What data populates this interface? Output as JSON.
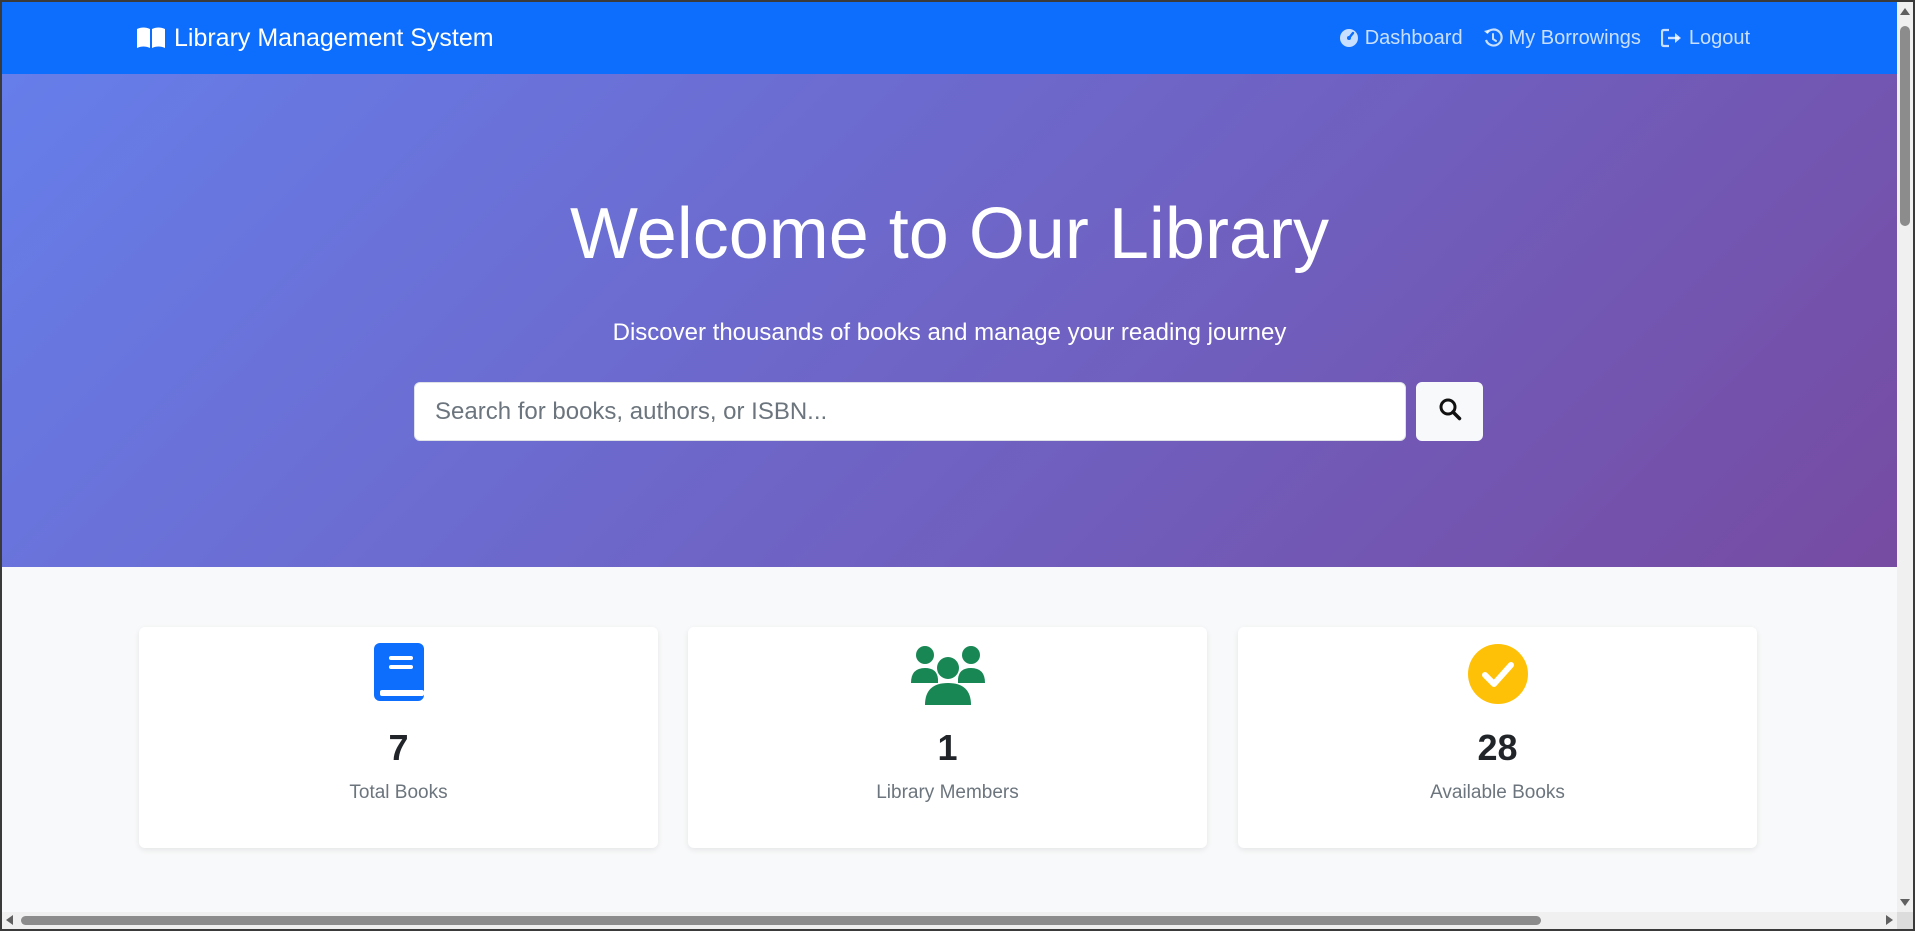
{
  "navbar": {
    "brand": "Library Management System",
    "brand_icon": "book-open-icon",
    "bg_color": "#0d6efd",
    "links": [
      {
        "label": "Dashboard",
        "icon": "speedometer-icon"
      },
      {
        "label": "My Borrowings",
        "icon": "history-icon"
      },
      {
        "label": "Logout",
        "icon": "sign-out-icon"
      }
    ]
  },
  "hero": {
    "title": "Welcome to Our Library",
    "subtitle": "Discover thousands of books and manage your reading journey",
    "gradient_start": "#667eea",
    "gradient_end": "#764ba2",
    "search": {
      "placeholder": "Search for books, authors, or ISBN...",
      "value": "",
      "button_icon": "search-icon"
    }
  },
  "stats": [
    {
      "value": "7",
      "label": "Total Books",
      "icon": "book-icon",
      "color": "#0d6efd"
    },
    {
      "value": "1",
      "label": "Library Members",
      "icon": "users-icon",
      "color": "#198754"
    },
    {
      "value": "28",
      "label": "Available Books",
      "icon": "check-circle-icon",
      "color": "#ffc107"
    }
  ]
}
